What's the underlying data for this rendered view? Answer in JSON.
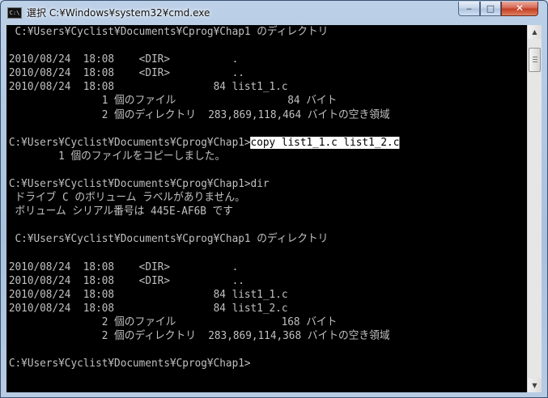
{
  "window": {
    "title": "選択 C:¥Windows¥system32¥cmd.exe",
    "icon_text": "C:\\",
    "icon": "console-app-icon",
    "controls": {
      "minimize": "‒",
      "maximize": "□",
      "close": "✕"
    }
  },
  "console": {
    "lines": [
      " C:¥Users¥Cyclist¥Documents¥Cprog¥Chap1 のディレクトリ",
      "",
      "2010/08/24  18:08    <DIR>          .",
      "2010/08/24  18:08    <DIR>          ..",
      "2010/08/24  18:08                84 list1_1.c",
      "               1 個のファイル                  84 バイト",
      "               2 個のディレクトリ  283,869,118,464 バイトの空き領域",
      "",
      "C:¥Users¥Cyclist¥Documents¥Cprog¥Chap1>",
      "        1 個のファイルをコピーしました。",
      "",
      "C:¥Users¥Cyclist¥Documents¥Cprog¥Chap1>dir",
      " ドライブ C のボリューム ラベルがありません。",
      " ボリューム シリアル番号は 445E-AF6B です",
      "",
      " C:¥Users¥Cyclist¥Documents¥Cprog¥Chap1 のディレクトリ",
      "",
      "2010/08/24  18:08    <DIR>          .",
      "2010/08/24  18:08    <DIR>          ..",
      "2010/08/24  18:08                84 list1_1.c",
      "2010/08/24  18:08                84 list1_2.c",
      "               2 個のファイル                 168 バイト",
      "               2 個のディレクトリ  283,869,114,368 バイトの空き領域",
      "",
      "C:¥Users¥Cyclist¥Documents¥Cprog¥Chap1>"
    ],
    "selected_text": "copy list1_1.c list1_2.c",
    "selected_line_index": 8
  },
  "scrollbar": {
    "up": "▲",
    "down": "▼",
    "icons": [
      "scroll-up-arrow-icon",
      "scroll-down-arrow-icon"
    ]
  },
  "colors": {
    "console_bg": "#000000",
    "console_text": "#c0c0c0",
    "selection_bg": "#ffffff",
    "selection_text": "#000000",
    "close_button": "#c23a22"
  }
}
